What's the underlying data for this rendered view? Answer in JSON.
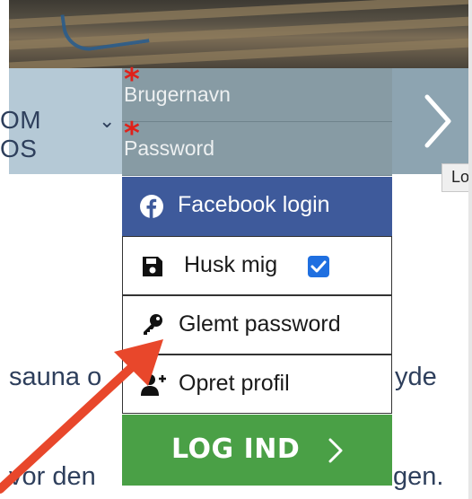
{
  "navbar": {
    "item_label": "OM OS",
    "item_chevron_icon": "chevron-down-icon",
    "next_icon": "chevron-right-icon"
  },
  "tooltip": {
    "text": "Lo"
  },
  "background_text": {
    "line1_left": "sauna o",
    "line1_right": "yde",
    "line2_left": "vor den",
    "line2_right": "gen."
  },
  "login_dropdown": {
    "username": {
      "placeholder": "Brugernavn",
      "required": true
    },
    "password": {
      "placeholder": "Password",
      "required": true
    },
    "facebook_label": "Facebook login",
    "remember_label": "Husk mig",
    "remember_checked": true,
    "forgot_label": "Glemt password",
    "create_label": "Opret profil",
    "login_label": "LOG IND"
  },
  "colors": {
    "nav_bg": "#b5c9d6",
    "field_bg": "#879ba4",
    "facebook_bg": "#3e5a9b",
    "login_bg": "#4aa046",
    "required_star": "#e0211a",
    "annotation_arrow": "#e8472b"
  }
}
